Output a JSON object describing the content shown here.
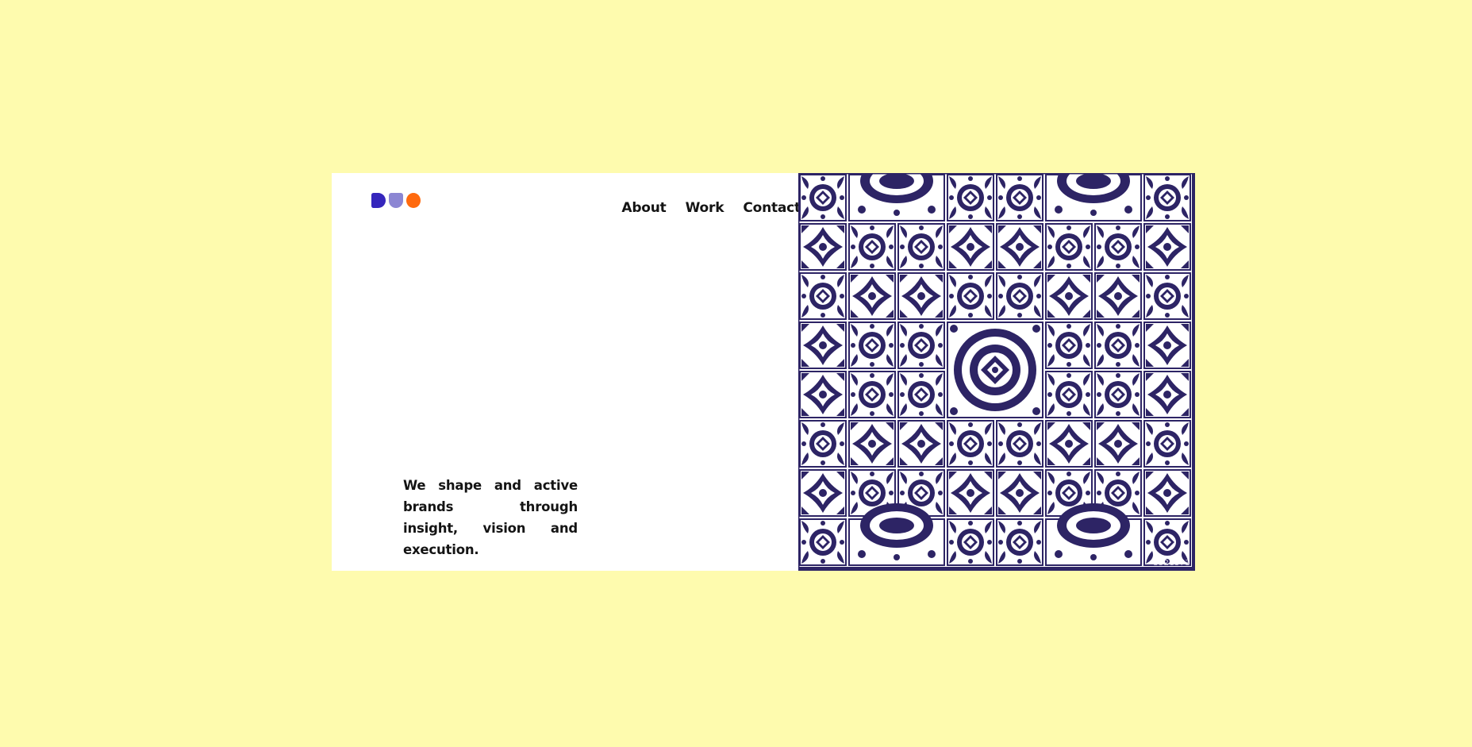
{
  "brand": {
    "logo_colors": [
      "#3526BC",
      "#8C86D3",
      "#FF6A0E"
    ]
  },
  "nav": {
    "items": [
      {
        "label": "About"
      },
      {
        "label": "Work"
      },
      {
        "label": "Contact"
      }
    ]
  },
  "hero": {
    "tagline": "We shape and active brands through insight, vision and execution."
  },
  "image": {
    "description_icon": "tile-pattern-image",
    "watermark": "3521373"
  },
  "colors": {
    "page_background": "#FEFBAE",
    "card_background": "#FFFFFF",
    "tile_navy": "#2D2465",
    "text": "#141414"
  }
}
